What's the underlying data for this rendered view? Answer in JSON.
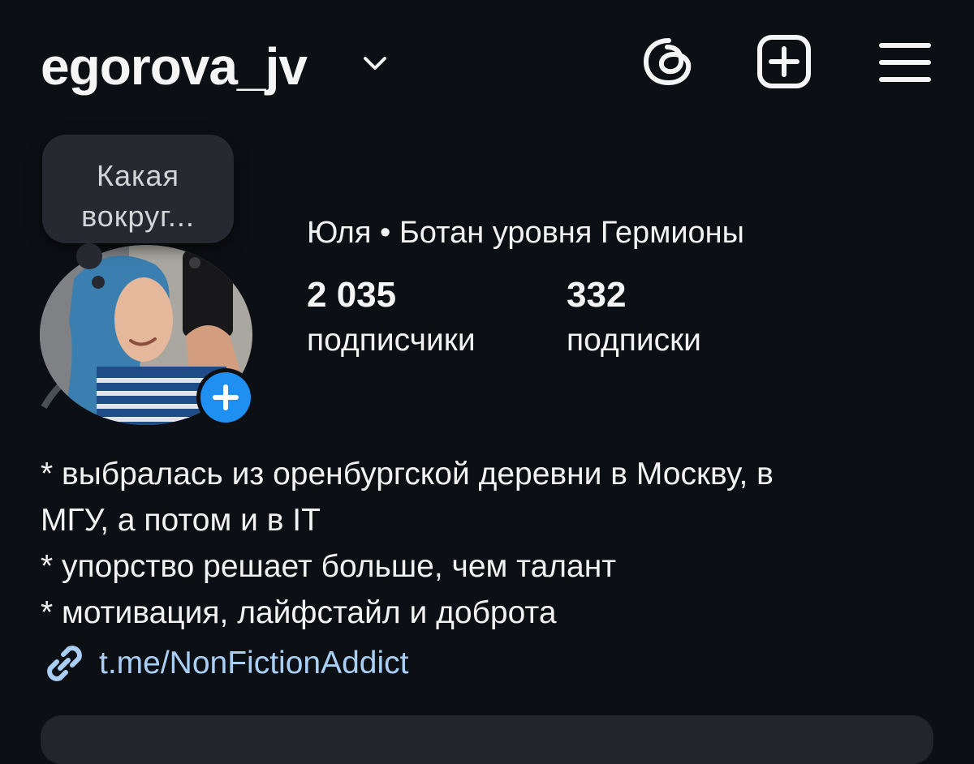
{
  "header": {
    "username": "egorova_jv",
    "icons": {
      "account_switch": "chevron-down-icon",
      "threads": "threads-icon",
      "create": "plus-square-icon",
      "menu": "hamburger-menu-icon"
    }
  },
  "note": {
    "text_line1": "Какая",
    "text_line2": "вокруг..."
  },
  "profile": {
    "display_name": "Юля • Ботан уровня Гермионы",
    "stats": [
      {
        "value": "2 035",
        "label": "подписчики"
      },
      {
        "value": "332",
        "label": "подписки"
      }
    ]
  },
  "bio": {
    "lines": [
      "* выбралась из оренбургской деревни в Москву, в",
      "МГУ, а потом и в IT",
      "* упорство решает больше, чем талант",
      "* мотивация, лайфстайл и доброта"
    ]
  },
  "link": {
    "icon": "link-icon",
    "text": "t.me/NonFictionAddict"
  },
  "colors": {
    "background": "#0c0f14",
    "text": "#f5f5f5",
    "link": "#a9cff6",
    "accent": "#1f8ff2",
    "card": "#22262c"
  }
}
